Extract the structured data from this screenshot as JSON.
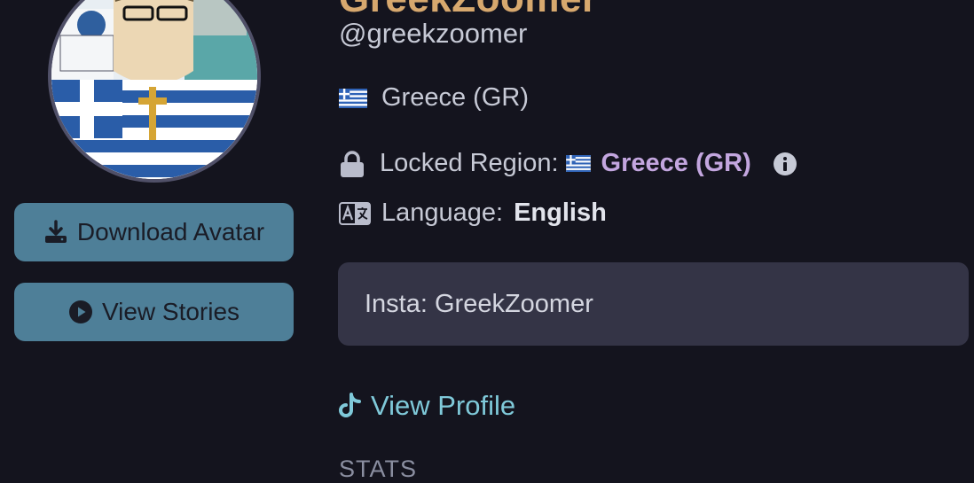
{
  "profile": {
    "display_name": "GreekZoomer",
    "handle": "@greekzoomer",
    "country": "Greece (GR)",
    "locked_region_label": "Locked Region:",
    "locked_region_value": "Greece (GR)",
    "language_label": "Language:",
    "language_value": "English",
    "bio": "Insta: GreekZoomer",
    "view_profile_label": "View Profile",
    "stats_heading": "STATS"
  },
  "buttons": {
    "download_avatar": "Download Avatar",
    "view_stories": "View Stories"
  },
  "icons": {
    "download": "download-icon",
    "play": "play-circle-icon",
    "flag": "greece-flag-icon",
    "lock": "lock-icon",
    "info": "info-icon",
    "language": "language-icon",
    "tiktok": "tiktok-icon"
  },
  "colors": {
    "background": "#14141e",
    "button": "#4e7f98",
    "accent_purple": "#c3a6df",
    "link": "#7fc9d9",
    "bio_bg": "#343446",
    "name": "#d7a86e"
  }
}
